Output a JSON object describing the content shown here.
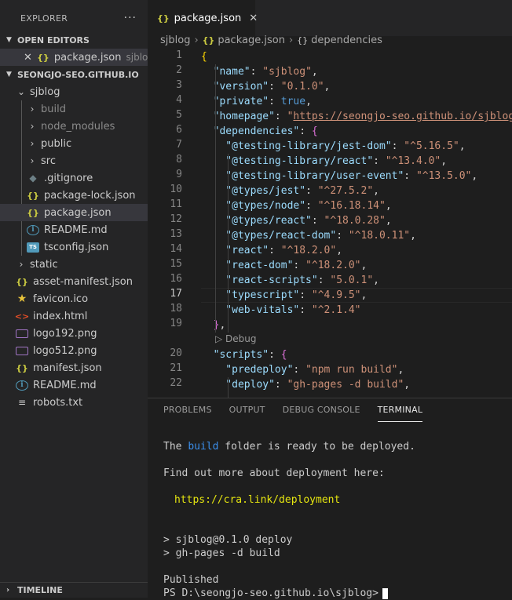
{
  "sidebar": {
    "title": "EXPLORER",
    "more": "···",
    "open_editors": {
      "header": "OPEN EDITORS",
      "items": [
        {
          "close": "✕",
          "icon": "{}",
          "name": "package.json",
          "desc": "sjblog"
        }
      ]
    },
    "workspace": {
      "header": "SEONGJO-SEO.GITHUB.IO",
      "root_folder": "sjblog",
      "root_children": [
        {
          "name": "build",
          "type": "folder"
        },
        {
          "name": "node_modules",
          "type": "folder"
        },
        {
          "name": "public",
          "type": "folder"
        },
        {
          "name": "src",
          "type": "folder"
        },
        {
          "name": ".gitignore",
          "type": "git"
        },
        {
          "name": "package-lock.json",
          "type": "json"
        },
        {
          "name": "package.json",
          "type": "json"
        },
        {
          "name": "README.md",
          "type": "info"
        },
        {
          "name": "tsconfig.json",
          "type": "ts"
        }
      ],
      "top_items": [
        {
          "name": "static",
          "type": "folder"
        },
        {
          "name": "asset-manifest.json",
          "type": "json"
        },
        {
          "name": "favicon.ico",
          "type": "star"
        },
        {
          "name": "index.html",
          "type": "html"
        },
        {
          "name": "logo192.png",
          "type": "img"
        },
        {
          "name": "logo512.png",
          "type": "img"
        },
        {
          "name": "manifest.json",
          "type": "json"
        },
        {
          "name": "README.md",
          "type": "info"
        },
        {
          "name": "robots.txt",
          "type": "txt"
        }
      ]
    },
    "timeline": "TIMELINE"
  },
  "editor": {
    "tab": {
      "icon": "{}",
      "label": "package.json",
      "close": "✕"
    },
    "breadcrumb": [
      "sjblog",
      "package.json",
      "dependencies"
    ],
    "code_lens": "Debug",
    "current_line": 17,
    "lines": [
      {
        "n": 1,
        "tokens": [
          [
            "br1",
            "{"
          ]
        ]
      },
      {
        "n": 2,
        "tokens": [
          [
            "key",
            "  \"name\""
          ],
          [
            "pun",
            ": "
          ],
          [
            "str",
            "\"sjblog\""
          ],
          [
            "pun",
            ","
          ]
        ]
      },
      {
        "n": 3,
        "tokens": [
          [
            "key",
            "  \"version\""
          ],
          [
            "pun",
            ": "
          ],
          [
            "str",
            "\"0.1.0\""
          ],
          [
            "pun",
            ","
          ]
        ]
      },
      {
        "n": 4,
        "tokens": [
          [
            "key",
            "  \"private\""
          ],
          [
            "pun",
            ": "
          ],
          [
            "kw",
            "true"
          ],
          [
            "pun",
            ","
          ]
        ]
      },
      {
        "n": 5,
        "tokens": [
          [
            "key",
            "  \"homepage\""
          ],
          [
            "pun",
            ": "
          ],
          [
            "str",
            "\""
          ],
          [
            "lnk",
            "https://seongjo-seo.github.io/sjblog"
          ],
          [
            "str",
            "\""
          ]
        ]
      },
      {
        "n": 6,
        "tokens": [
          [
            "key",
            "  \"dependencies\""
          ],
          [
            "pun",
            ": "
          ],
          [
            "br2",
            "{"
          ]
        ]
      },
      {
        "n": 7,
        "tokens": [
          [
            "key",
            "    \"@testing-library/jest-dom\""
          ],
          [
            "pun",
            ": "
          ],
          [
            "str",
            "\"^5.16.5\""
          ],
          [
            "pun",
            ","
          ]
        ]
      },
      {
        "n": 8,
        "tokens": [
          [
            "key",
            "    \"@testing-library/react\""
          ],
          [
            "pun",
            ": "
          ],
          [
            "str",
            "\"^13.4.0\""
          ],
          [
            "pun",
            ","
          ]
        ]
      },
      {
        "n": 9,
        "tokens": [
          [
            "key",
            "    \"@testing-library/user-event\""
          ],
          [
            "pun",
            ": "
          ],
          [
            "str",
            "\"^13.5.0\""
          ],
          [
            "pun",
            ","
          ]
        ]
      },
      {
        "n": 10,
        "tokens": [
          [
            "key",
            "    \"@types/jest\""
          ],
          [
            "pun",
            ": "
          ],
          [
            "str",
            "\"^27.5.2\""
          ],
          [
            "pun",
            ","
          ]
        ]
      },
      {
        "n": 11,
        "tokens": [
          [
            "key",
            "    \"@types/node\""
          ],
          [
            "pun",
            ": "
          ],
          [
            "str",
            "\"^16.18.14\""
          ],
          [
            "pun",
            ","
          ]
        ]
      },
      {
        "n": 12,
        "tokens": [
          [
            "key",
            "    \"@types/react\""
          ],
          [
            "pun",
            ": "
          ],
          [
            "str",
            "\"^18.0.28\""
          ],
          [
            "pun",
            ","
          ]
        ]
      },
      {
        "n": 13,
        "tokens": [
          [
            "key",
            "    \"@types/react-dom\""
          ],
          [
            "pun",
            ": "
          ],
          [
            "str",
            "\"^18.0.11\""
          ],
          [
            "pun",
            ","
          ]
        ]
      },
      {
        "n": 14,
        "tokens": [
          [
            "key",
            "    \"react\""
          ],
          [
            "pun",
            ": "
          ],
          [
            "str",
            "\"^18.2.0\""
          ],
          [
            "pun",
            ","
          ]
        ]
      },
      {
        "n": 15,
        "tokens": [
          [
            "key",
            "    \"react-dom\""
          ],
          [
            "pun",
            ": "
          ],
          [
            "str",
            "\"^18.2.0\""
          ],
          [
            "pun",
            ","
          ]
        ]
      },
      {
        "n": 16,
        "tokens": [
          [
            "key",
            "    \"react-scripts\""
          ],
          [
            "pun",
            ": "
          ],
          [
            "str",
            "\"5.0.1\""
          ],
          [
            "pun",
            ","
          ]
        ]
      },
      {
        "n": 17,
        "tokens": [
          [
            "key",
            "    \"typescript\""
          ],
          [
            "pun",
            ": "
          ],
          [
            "str",
            "\"^4.9.5\""
          ],
          [
            "pun",
            ","
          ]
        ]
      },
      {
        "n": 18,
        "tokens": [
          [
            "key",
            "    \"web-vitals\""
          ],
          [
            "pun",
            ": "
          ],
          [
            "str",
            "\"^2.1.4\""
          ]
        ]
      },
      {
        "n": 19,
        "tokens": [
          [
            "br2",
            "  }"
          ],
          [
            "pun",
            ","
          ]
        ]
      },
      {
        "n": 20,
        "tokens": [
          [
            "key",
            "  \"scripts\""
          ],
          [
            "pun",
            ": "
          ],
          [
            "br2",
            "{"
          ]
        ]
      },
      {
        "n": 21,
        "tokens": [
          [
            "key",
            "    \"predeploy\""
          ],
          [
            "pun",
            ": "
          ],
          [
            "str",
            "\"npm run build\""
          ],
          [
            "pun",
            ","
          ]
        ]
      },
      {
        "n": 22,
        "tokens": [
          [
            "key",
            "    \"deploy\""
          ],
          [
            "pun",
            ": "
          ],
          [
            "str",
            "\"gh-pages -d build\""
          ],
          [
            "pun",
            ","
          ]
        ]
      }
    ]
  },
  "panel": {
    "tabs": [
      "PROBLEMS",
      "OUTPUT",
      "DEBUG CONSOLE",
      "TERMINAL"
    ],
    "active_tab": "TERMINAL",
    "terminal": {
      "ready_prefix": "The ",
      "ready_word": "build",
      "ready_suffix": " folder is ready to be deployed.",
      "find_out": "Find out more about deployment here:",
      "deploy_link": "https://cra.link/deployment",
      "cmd1": "> sjblog@0.1.0 deploy",
      "cmd2": "> gh-pages -d build",
      "published": "Published",
      "prompt": "PS D:\\seongjo-seo.github.io\\sjblog>"
    }
  }
}
